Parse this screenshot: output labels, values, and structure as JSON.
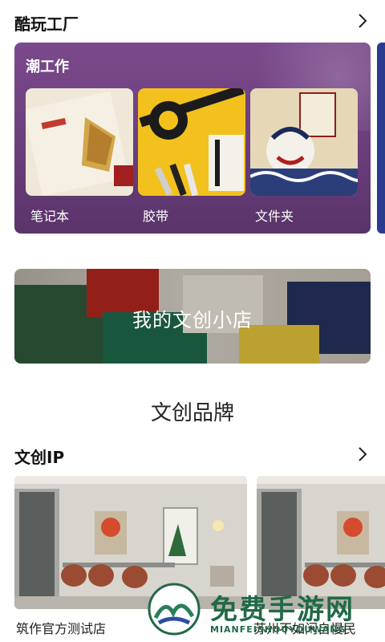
{
  "sections": {
    "cool_factory": {
      "title": "酷玩工厂"
    },
    "ip": {
      "title": "文创IP"
    }
  },
  "trend": {
    "title": "潮工作",
    "items": [
      {
        "label": "笔记本"
      },
      {
        "label": "胶带"
      },
      {
        "label": "文件夹"
      }
    ]
  },
  "shop_banner": {
    "title": "我的文创小店"
  },
  "brand_heading": "文创品牌",
  "stores": [
    {
      "name": "筑作官方测试店"
    },
    {
      "name": "苏州不如闲自慢民"
    }
  ],
  "watermark": {
    "main": "免费手游网",
    "sub": "MIANFEISHOUYOUWANG"
  },
  "colors": {
    "banner_purple": "#6a3d7c",
    "peek_blue": "#2a3b8f",
    "watermark_green": "#1f6a46"
  }
}
